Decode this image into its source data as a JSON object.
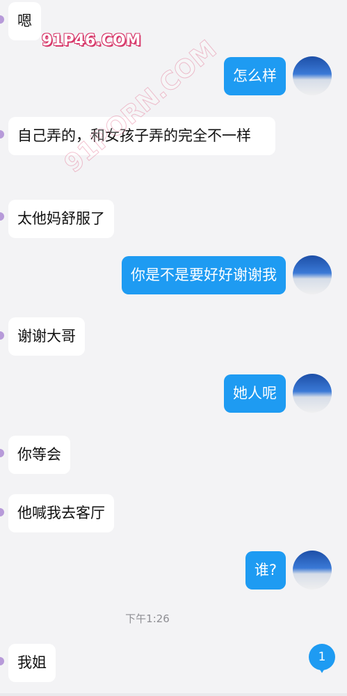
{
  "messages": [
    {
      "side": "in",
      "text": "嗯"
    },
    {
      "side": "out",
      "text": "怎么样"
    },
    {
      "side": "in",
      "text": "自己弄的，和女孩子弄的完全不一样"
    },
    {
      "side": "in",
      "text": "太他妈舒服了"
    },
    {
      "side": "out",
      "text": "你是不是要好好谢谢我"
    },
    {
      "side": "in",
      "text": "谢谢大哥"
    },
    {
      "side": "out",
      "text": "她人呢"
    },
    {
      "side": "in",
      "text": "你等会"
    },
    {
      "side": "in",
      "text": "他喊我去客厅"
    },
    {
      "side": "out",
      "text": "谁?"
    },
    {
      "side": "in",
      "text": "我姐"
    }
  ],
  "timestamp": "下午1:26",
  "unread_badge": "1",
  "watermarks": {
    "site": "91P46.COM",
    "diagonal": "91PORN.COM"
  },
  "colors": {
    "outgoing_bubble": "#1e9bf2",
    "incoming_bubble": "#ffffff",
    "background": "#f3f3f5"
  }
}
